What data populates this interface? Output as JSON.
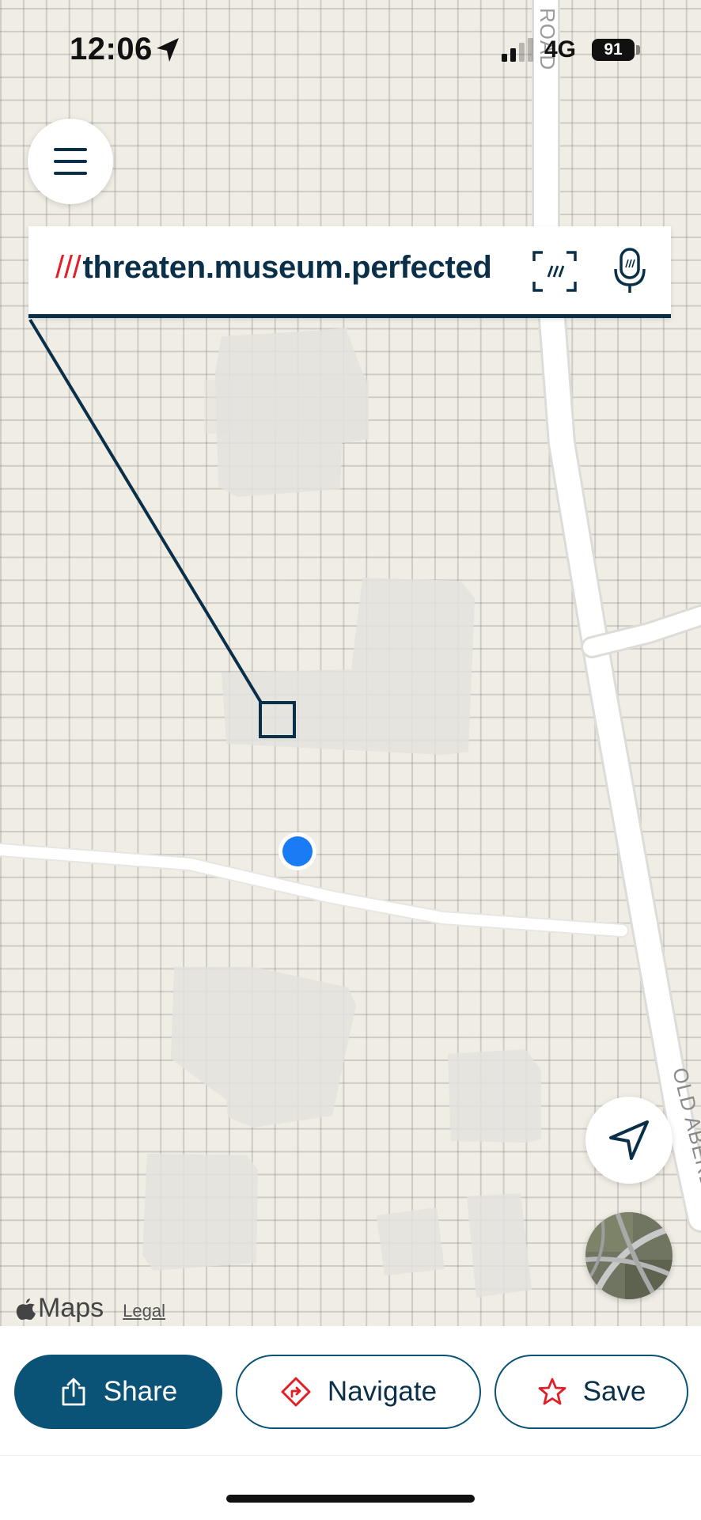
{
  "status_bar": {
    "time": "12:06",
    "network": "4G",
    "battery": "91"
  },
  "map": {
    "road_labels": [
      "ROAD",
      "OLD ABERD"
    ],
    "attribution": "Maps",
    "legal": "Legal"
  },
  "search_bar": {
    "slashes": "///",
    "address": "threaten.museum.perfected"
  },
  "toolbar": {
    "share_label": "Share",
    "navigate_label": "Navigate",
    "save_label": "Save"
  },
  "colors": {
    "brand_navy": "#0a3049",
    "share_blue": "#0a5276",
    "slash_red": "#e11f26",
    "user_dot": "#1a7cf5",
    "map_bg": "#f0ede5"
  },
  "icons": {
    "menu": "hamburger-icon",
    "scan": "scan-icon",
    "mic": "microphone-icon",
    "locate": "navigation-arrow-icon",
    "share": "share-icon",
    "navigate": "directions-diamond-icon",
    "save": "star-icon"
  }
}
